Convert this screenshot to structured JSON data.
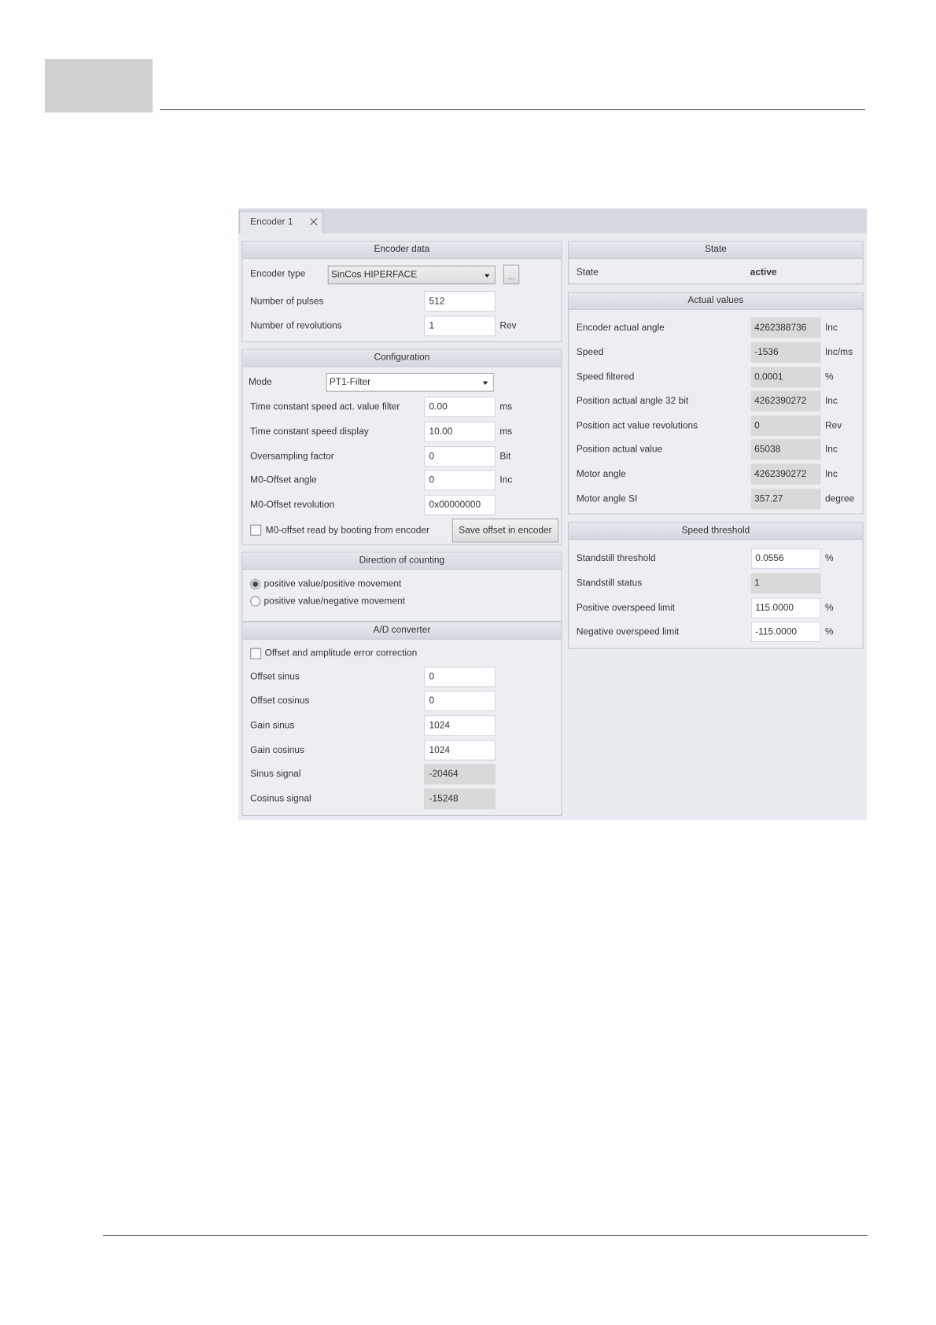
{
  "tab": {
    "label": "Encoder 1",
    "close_icon": "close-icon"
  },
  "encoder_data": {
    "title": "Encoder data",
    "encoder_type": {
      "label": "Encoder type",
      "value": "SinCos HIPERFACE",
      "browse_label": "..."
    },
    "number_of_pulses": {
      "label": "Number of pulses",
      "value": "512"
    },
    "number_of_revolutions": {
      "label": "Number of revolutions",
      "value": "1",
      "unit": "Rev"
    }
  },
  "configuration": {
    "title": "Configuration",
    "mode": {
      "label": "Mode",
      "value": "PT1-Filter"
    },
    "rows": [
      {
        "label": "Time constant speed act. value filter",
        "value": "0.00",
        "unit": "ms"
      },
      {
        "label": "Time constant speed display",
        "value": "10.00",
        "unit": "ms"
      },
      {
        "label": "Oversampling factor",
        "value": "0",
        "unit": "Bit"
      },
      {
        "label": "M0-Offset angle",
        "value": "0",
        "unit": "Inc"
      },
      {
        "label": "M0-Offset revolution",
        "value": "0x00000000",
        "unit": ""
      }
    ],
    "read_on_boot": {
      "label": "M0-offset read by booting from encoder",
      "checked": false
    },
    "save_button": "Save offset in encoder"
  },
  "direction_of_counting": {
    "title": "Direction of counting",
    "options": [
      {
        "label": "positive value/positive movement",
        "selected": true
      },
      {
        "label": "positive value/negative movement",
        "selected": false
      }
    ]
  },
  "ad_converter": {
    "title": "A/D converter",
    "error_correction": {
      "label": "Offset and amplitude error correction",
      "checked": false
    },
    "rows": [
      {
        "label": "Offset sinus",
        "value": "0"
      },
      {
        "label": "Offset cosinus",
        "value": "0"
      },
      {
        "label": "Gain sinus",
        "value": "1024"
      },
      {
        "label": "Gain cosinus",
        "value": "1024"
      },
      {
        "label": "Sinus signal",
        "value": "-20464"
      },
      {
        "label": "Cosinus signal",
        "value": "-15248"
      }
    ]
  },
  "state": {
    "title": "State",
    "label": "State",
    "value": "active"
  },
  "actual_values": {
    "title": "Actual values",
    "rows": [
      {
        "label": "Encoder actual angle",
        "value": "4262388736",
        "unit": "Inc"
      },
      {
        "label": "Speed",
        "value": "-1536",
        "unit": "Inc/ms"
      },
      {
        "label": "Speed filtered",
        "value": "0.0001",
        "unit": "%"
      },
      {
        "label": "Position actual angle 32 bit",
        "value": "4262390272",
        "unit": "Inc"
      },
      {
        "label": "Position act value revolutions",
        "value": "0",
        "unit": "Rev"
      },
      {
        "label": "Position actual value",
        "value": "65038",
        "unit": "Inc"
      },
      {
        "label": "Motor angle",
        "value": "4262390272",
        "unit": "Inc"
      },
      {
        "label": "Motor angle SI",
        "value": "357.27",
        "unit": "degree"
      }
    ]
  },
  "speed_threshold": {
    "title": "Speed threshold",
    "rows": [
      {
        "label": "Standstill threshold",
        "value": "0.0556",
        "unit": "%"
      },
      {
        "label": "Standstill status",
        "value": "1",
        "unit": ""
      },
      {
        "label": "Positive overspeed limit",
        "value": "115.0000",
        "unit": "%"
      },
      {
        "label": "Negative overspeed limit",
        "value": "-115.0000",
        "unit": "%"
      }
    ]
  }
}
